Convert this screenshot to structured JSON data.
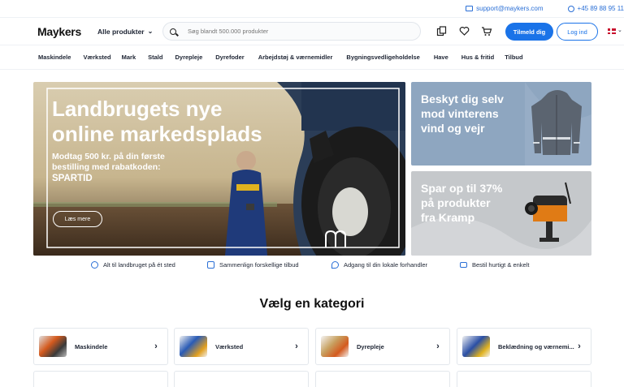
{
  "topbar": {
    "email": "support@maykers.com",
    "phone": "+45 89 88 95 11"
  },
  "header": {
    "logo": "Maykers",
    "all_products": "Alle produkter",
    "search_placeholder": "Søg blandt 500.000 produkter",
    "signup_label": "Tilmeld dig",
    "login_label": "Log ind",
    "icons": [
      "compare-icon",
      "heart-icon",
      "cart-icon"
    ]
  },
  "nav": {
    "items": [
      "Maskindele",
      "Værksted",
      "Mark",
      "Stald",
      "Dyrepleje",
      "Dyrefoder",
      "Arbejdstøj & værnemidler",
      "Bygningsvedligeholdelse",
      "Have",
      "Hus & fritid",
      "Tilbud"
    ]
  },
  "hero": {
    "title_line1": "Landbrugets nye",
    "title_line2": "online markedsplads",
    "sub_line1": "Modtag 500 kr. på din første",
    "sub_line2": "bestilling med rabatkoden:",
    "code": "SPARTID",
    "cta": "Læs mere"
  },
  "promo1": {
    "line1": "Beskyt dig selv",
    "line2": "mod vinterens",
    "line3": "vind og vejr"
  },
  "promo2": {
    "line1": "Spar op til 37%",
    "line2": "på produkter",
    "line3": "fra Kramp"
  },
  "usps": [
    "Alt til landbruget på ét sted",
    "Sammenlign forskellige tilbud",
    "Adgang til din lokale forhandler",
    "Bestil hurtigt & enkelt"
  ],
  "categories_title": "Vælg en kategori",
  "categories": [
    "Maskindele",
    "Værksted",
    "Dyrepleje",
    "Beklædning og værnemi..."
  ],
  "colors": {
    "accent": "#1a73e8",
    "promo1_bg": "#8ea6c0",
    "promo2_bg": "#c5c8cb"
  }
}
